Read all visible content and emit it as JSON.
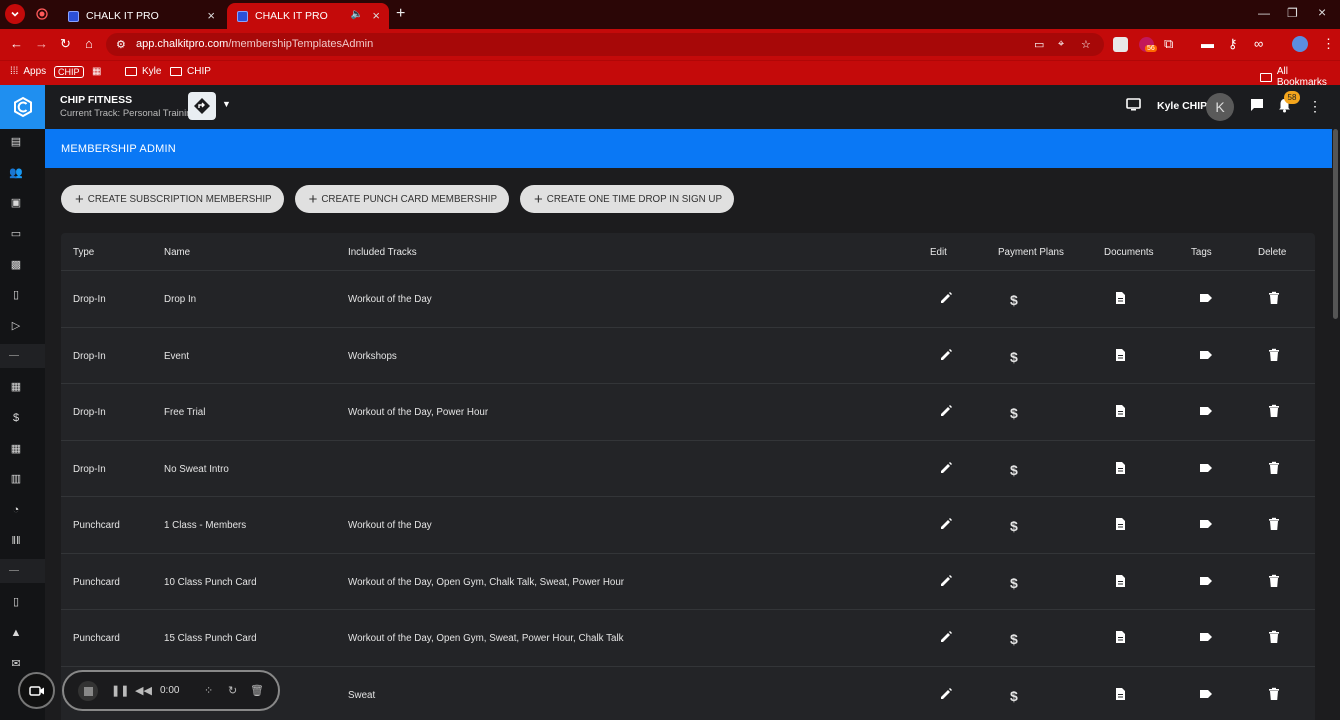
{
  "browser": {
    "tabs": [
      {
        "title": "CHALK IT PRO",
        "active": false
      },
      {
        "title": "CHALK IT PRO",
        "active": true
      }
    ],
    "url_host": "app.chalkitpro.com",
    "url_path": "/membershipTemplatesAdmin",
    "bookmarks": {
      "apps": "Apps",
      "chip_badge": "CHIP",
      "folder1": "Kyle",
      "folder2": "CHIP",
      "all": "All Bookmarks"
    },
    "ext_badge": "56"
  },
  "header": {
    "org_name": "CHIP FITNESS",
    "track": "Current Track: Personal Training",
    "user_name": "Kyle CHIP",
    "avatar_initial": "K",
    "notif_count": "58"
  },
  "banner": {
    "title": "MEMBERSHIP ADMIN"
  },
  "actions": {
    "subscription": "CREATE SUBSCRIPTION MEMBERSHIP",
    "punch": "CREATE PUNCH CARD MEMBERSHIP",
    "drop_in": "CREATE ONE TIME DROP IN SIGN UP"
  },
  "table": {
    "headers": {
      "type": "Type",
      "name": "Name",
      "tracks": "Included Tracks",
      "edit": "Edit",
      "payment": "Payment Plans",
      "documents": "Documents",
      "tags": "Tags",
      "delete": "Delete"
    },
    "rows": [
      {
        "type": "Drop-In",
        "name": "Drop In",
        "tracks": "Workout of the Day"
      },
      {
        "type": "Drop-In",
        "name": "Event",
        "tracks": "Workshops"
      },
      {
        "type": "Drop-In",
        "name": "Free Trial",
        "tracks": "Workout of the Day, Power Hour"
      },
      {
        "type": "Drop-In",
        "name": "No Sweat Intro",
        "tracks": ""
      },
      {
        "type": "Punchcard",
        "name": "1 Class - Members",
        "tracks": "Workout of the Day"
      },
      {
        "type": "Punchcard",
        "name": "10 Class Punch Card",
        "tracks": "Workout of the Day, Open Gym, Chalk Talk, Sweat, Power Hour"
      },
      {
        "type": "Punchcard",
        "name": "15 Class Punch Card",
        "tracks": "Workout of the Day, Open Gym, Sweat, Power Hour, Chalk Talk"
      },
      {
        "type": "",
        "name": "",
        "tracks": "Sweat"
      }
    ],
    "dollar": "$"
  },
  "recorder": {
    "time": "0:00"
  },
  "colors": {
    "chrome": "#c40a0a",
    "banner": "#0a78f5",
    "logo": "#1f8ff0",
    "badge": "#f4a51c"
  }
}
